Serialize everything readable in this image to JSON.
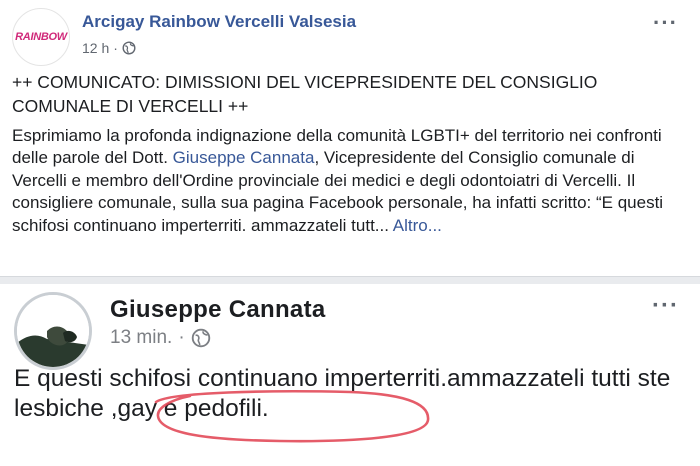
{
  "post1": {
    "avatar_text": "RAINBOW",
    "page_name": "Arcigay Rainbow Vercelli Valsesia",
    "time": "12 h",
    "dot": "·",
    "more": "···",
    "headline": "++ COMUNICATO: DIMISSIONI DEL VICEPRESIDENTE DEL CONSIGLIO COMUNALE DI VERCELLI ++",
    "body_before": "Esprimiamo la profonda indignazione della comunità LGBTI+ del territorio nei confronti delle parole del Dott. ",
    "body_link": "Giuseppe Cannata",
    "body_after": ", Vicepresidente del Consiglio comunale di Vercelli e membro dell'Ordine provinciale dei medici e degli odontoiatri di Vercelli. Il consigliere comunale, sulla sua pagina Facebook personale, ha infatti scritto: “E questi schifosi continuano imperterriti. ammazzateli tutt...",
    "more_link": "Altro..."
  },
  "post2": {
    "name": "Giuseppe Cannata",
    "time": "13 min.",
    "dot": "·",
    "more": "···",
    "body": "E questi schifosi continuano imperterriti.ammazzateli tutti ste lesbiche ,gay e pedofili."
  },
  "colors": {
    "link": "#385898",
    "text": "#1c1e21",
    "meta": "#616770",
    "annotation": "#e0404f"
  },
  "icons": [
    "globe-icon",
    "more-options-icon"
  ]
}
